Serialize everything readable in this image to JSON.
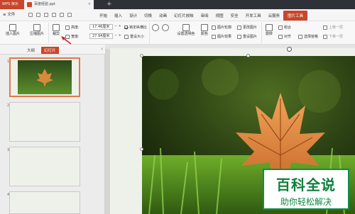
{
  "titlebar": {
    "app_name": "WPS 演示",
    "doc_tab": "百度经验.ppt",
    "close_symbol": "×",
    "new_tab_symbol": "+"
  },
  "menubar": {
    "file_label": "≡ 文件",
    "items": [
      "开始",
      "插入",
      "设计",
      "切换",
      "动画",
      "幻灯片放映",
      "审阅",
      "视图",
      "安全",
      "开发工具",
      "云服务",
      "图片工具"
    ],
    "active_index": 11
  },
  "ribbon": {
    "insert_picture": "插入图片",
    "compress_picture": "压缩图片",
    "crop": "裁剪",
    "height_label": "高度:",
    "height_value": "17.46厘米",
    "width_label": "宽度:",
    "width_value": "27.94厘米",
    "lock_ratio": "锁定纵横比",
    "reset_size": "重设大小",
    "set_transparent": "设置透明色",
    "color": "颜色",
    "picture_outline": "图片轮廓",
    "picture_effect": "图片效果",
    "change_picture": "更改图片",
    "reset_picture": "重设图片",
    "rotate": "旋转",
    "align": "对齐",
    "group": "组合",
    "select_pane": "选择窗格",
    "bring_forward": "上移一层",
    "send_backward": "下移一层"
  },
  "panel": {
    "tab_outline": "大纲",
    "tab_slides": "幻灯片",
    "slide_numbers": [
      "1",
      "2",
      "3",
      "4"
    ],
    "selected_slide": 1
  },
  "watermark": {
    "line1": "百科全说",
    "line2": "助你轻松解决"
  },
  "colors": {
    "accent": "#c9462c",
    "watermark_green": "#0f7f3c"
  }
}
